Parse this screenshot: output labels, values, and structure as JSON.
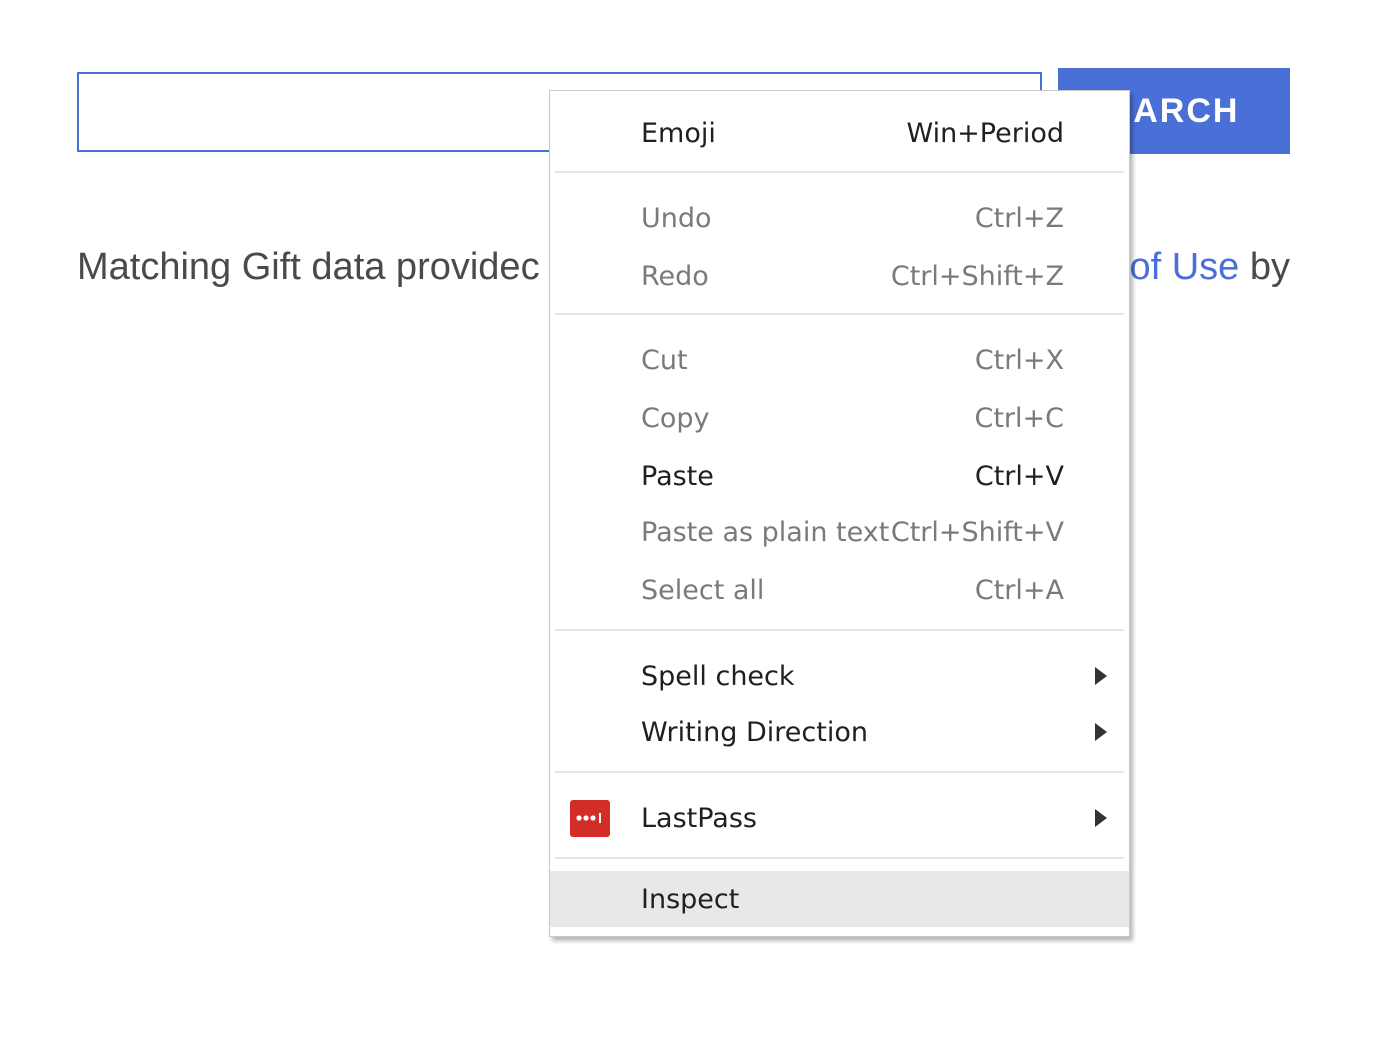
{
  "page": {
    "search_button_label": "EARCH",
    "attribution_left": "Matching Gift data providec",
    "attribution_link": "of Use",
    "attribution_right": "by"
  },
  "colors": {
    "accent": "#4a6fd6",
    "menu_highlight": "#e8e8e9",
    "lastpass_red": "#d32d27"
  },
  "context_menu": {
    "emoji": {
      "label": "Emoji",
      "shortcut": "Win+Period"
    },
    "undo": {
      "label": "Undo",
      "shortcut": "Ctrl+Z"
    },
    "redo": {
      "label": "Redo",
      "shortcut": "Ctrl+Shift+Z"
    },
    "cut": {
      "label": "Cut",
      "shortcut": "Ctrl+X"
    },
    "copy": {
      "label": "Copy",
      "shortcut": "Ctrl+C"
    },
    "paste": {
      "label": "Paste",
      "shortcut": "Ctrl+V"
    },
    "paste_plain": {
      "label": "Paste as plain text",
      "shortcut": "Ctrl+Shift+V"
    },
    "select_all": {
      "label": "Select all",
      "shortcut": "Ctrl+A"
    },
    "spell_check": {
      "label": "Spell check"
    },
    "writing_direction": {
      "label": "Writing Direction"
    },
    "lastpass": {
      "label": "LastPass",
      "icon": "lastpass-icon"
    },
    "inspect": {
      "label": "Inspect"
    }
  }
}
